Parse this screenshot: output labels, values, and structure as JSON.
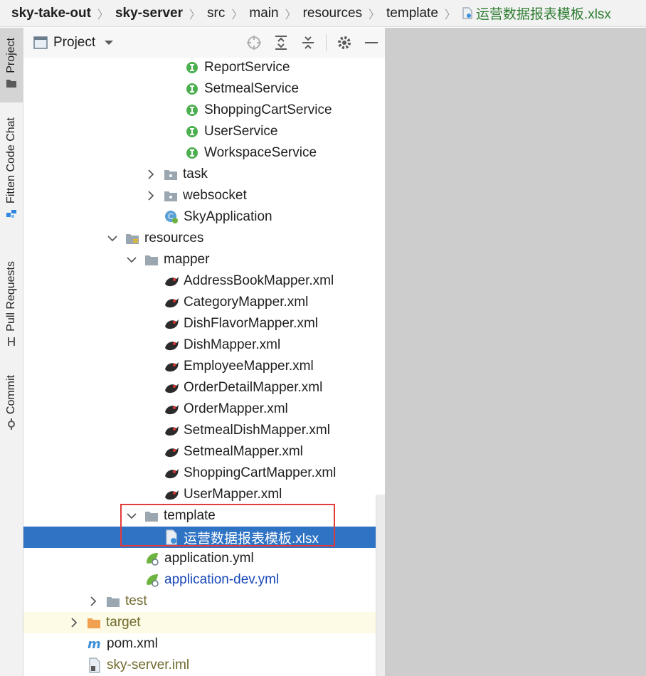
{
  "breadcrumb": [
    "sky-take-out",
    "sky-server",
    "src",
    "main",
    "resources",
    "template",
    "运营数据报表模板.xlsx"
  ],
  "toolstrip": {
    "project": "Project",
    "fitten": "Fitten Code Chat",
    "pull_requests": "Pull Requests",
    "commit": "Commit"
  },
  "panel": {
    "title": "Project"
  },
  "tree": {
    "report_service": "ReportService",
    "setmeal_service": "SetmealService",
    "shopping_cart_service": "ShoppingCartService",
    "user_service": "UserService",
    "workspace_service": "WorkspaceService",
    "task": "task",
    "websocket": "websocket",
    "sky_application": "SkyApplication",
    "resources": "resources",
    "mapper": "mapper",
    "mappers": [
      "AddressBookMapper.xml",
      "CategoryMapper.xml",
      "DishFlavorMapper.xml",
      "DishMapper.xml",
      "EmployeeMapper.xml",
      "OrderDetailMapper.xml",
      "OrderMapper.xml",
      "SetmealDishMapper.xml",
      "SetmealMapper.xml",
      "ShoppingCartMapper.xml",
      "UserMapper.xml"
    ],
    "template": "template",
    "template_file": "运营数据报表模板.xlsx",
    "application_yml": "application.yml",
    "application_dev_yml": "application-dev.yml",
    "test": "test",
    "target": "target",
    "pom": "pom.xml",
    "iml": "sky-server.iml"
  },
  "colors": {
    "selection": "#2f73c4",
    "highlight_box": "#e23b3b",
    "interface_badge": "#4caf50",
    "folder": "#9aa7b0",
    "target_folder": "#f0a050"
  }
}
